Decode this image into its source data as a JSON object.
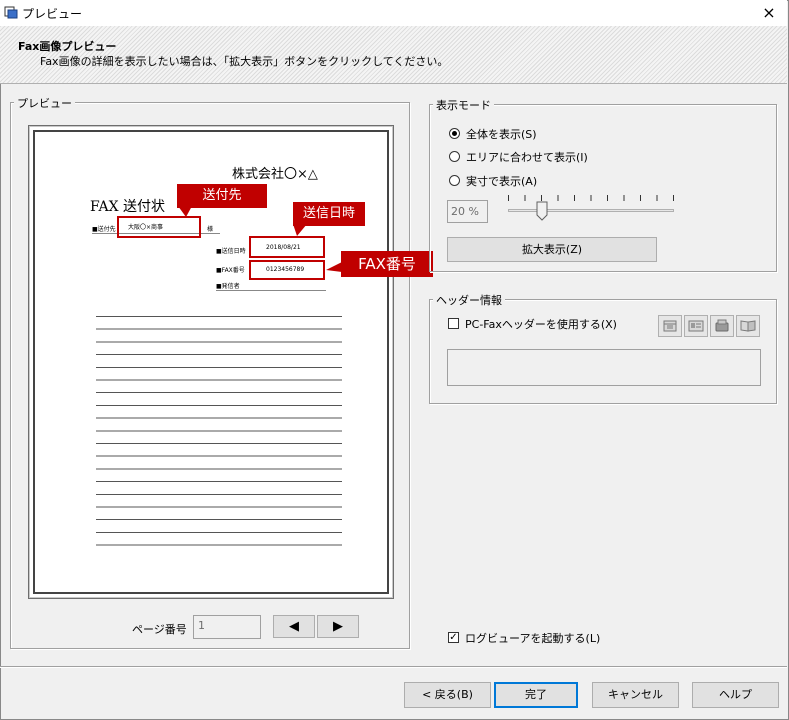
{
  "window": {
    "title": "プレビュー"
  },
  "header": {
    "title": "Fax画像プレビュー",
    "description": "Fax画像の詳細を表示したい場合は、「拡大表示」ボタンをクリックしてください。"
  },
  "preview": {
    "group_label": "プレビュー",
    "document": {
      "company": "株式会社〇×△",
      "title": "FAX 送付状",
      "to_label": "■送付先",
      "to_value": "大阪〇×商事",
      "to_suffix": "様",
      "date_label": "■送信日時",
      "date_value": "2018/08/21",
      "fax_label": "■FAX番号",
      "fax_value": "0123456789",
      "sender_label": "■発信者"
    },
    "callouts": {
      "to": "送付先",
      "date": "送信日時",
      "fax": "FAX番号"
    },
    "page_label": "ページ番号",
    "page_value": "1",
    "prev_glyph": "◀",
    "next_glyph": "▶"
  },
  "display_mode": {
    "group_label": "表示モード",
    "options": [
      {
        "label": "全体を表示(S)",
        "checked": true
      },
      {
        "label": "エリアに合わせて表示(I)",
        "checked": false
      },
      {
        "label": "実寸で表示(A)",
        "checked": false
      }
    ],
    "zoom_value": "20 %",
    "zoom_level_percent": 20,
    "zoom_button": "拡大表示(Z)"
  },
  "header_info": {
    "group_label": "ヘッダー情報",
    "use_header_label": "PC-Faxヘッダーを使用する(X)",
    "use_header_checked": false,
    "text_value": ""
  },
  "log_viewer": {
    "label": "ログビューアを起動する(L)",
    "checked": true,
    "check_glyph": "✓"
  },
  "footer": {
    "back": "< 戻る(B)",
    "finish": "完了",
    "cancel": "キャンセル",
    "help": "ヘルプ"
  },
  "colors": {
    "accent": "#c00000",
    "focus": "#0078d7"
  },
  "icons": {
    "close": "×"
  }
}
